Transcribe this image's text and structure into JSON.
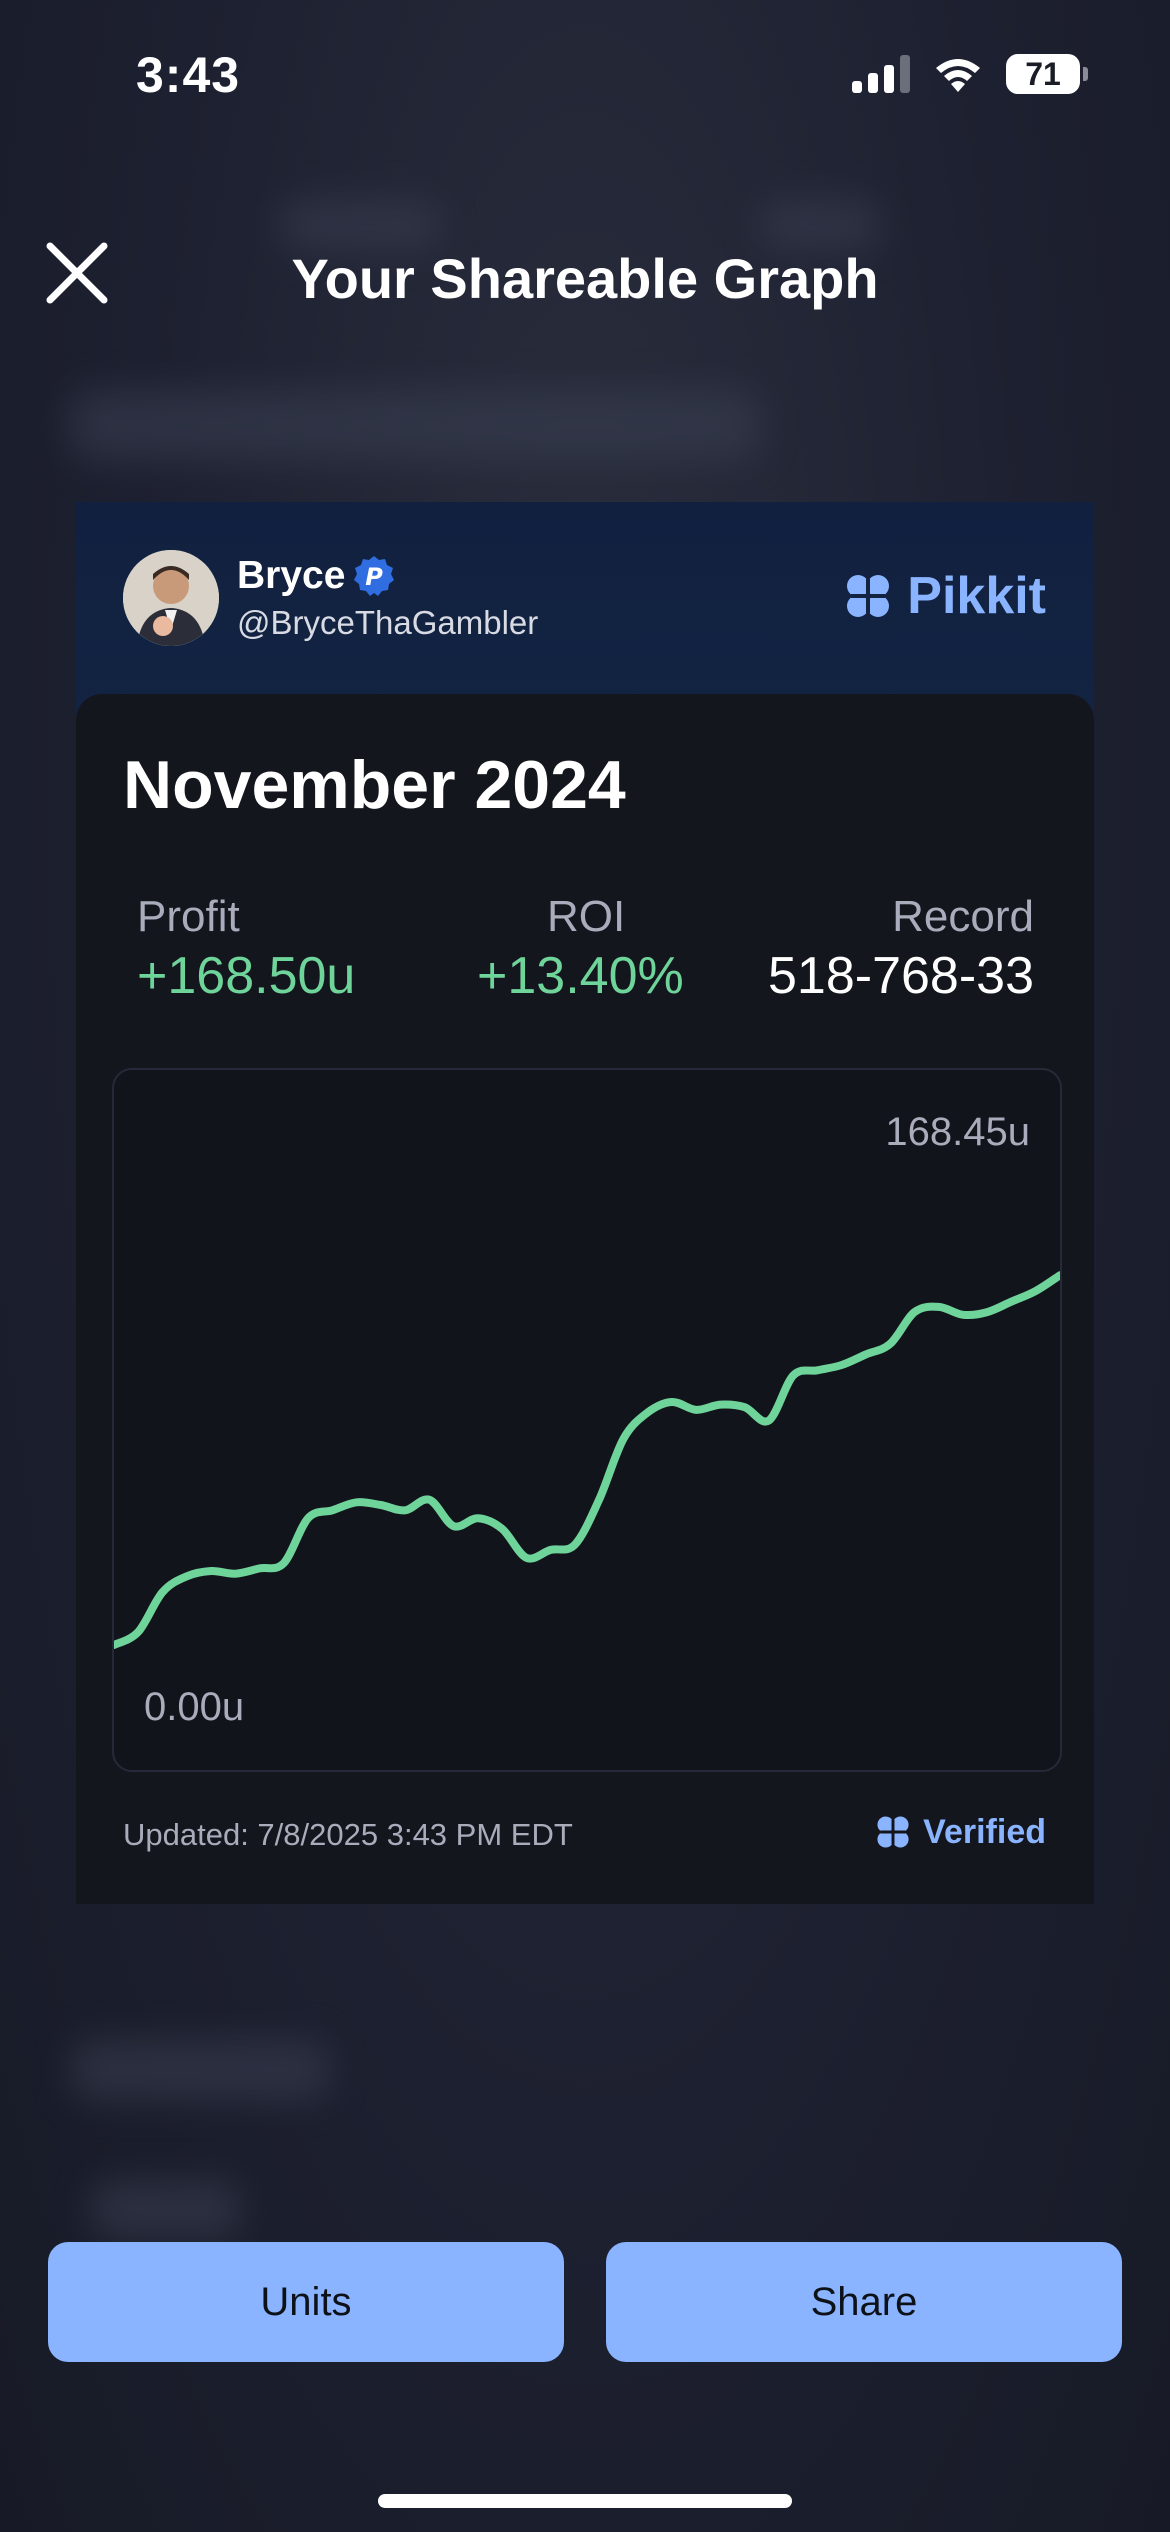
{
  "status_bar": {
    "time": "3:43",
    "battery": "71"
  },
  "header": {
    "title": "Your Shareable Graph"
  },
  "card": {
    "user": {
      "name": "Bryce",
      "handle": "@BryceThaGambler"
    },
    "brand": "Pikkit",
    "period": "November 2024",
    "stats": {
      "profit": {
        "label": "Profit",
        "value": "+168.50u"
      },
      "roi": {
        "label": "ROI",
        "value": "+13.40%"
      },
      "record": {
        "label": "Record",
        "value": "518-768-33"
      }
    },
    "graph": {
      "max_label": "168.45u",
      "min_label": "0.00u"
    },
    "updated": "Updated: 7/8/2025 3:43 PM EDT",
    "verified": "Verified"
  },
  "actions": {
    "units": "Units",
    "share": "Share"
  },
  "colors": {
    "accent": "#8ab4ff",
    "positive": "#6fd49a",
    "card_bg": "#14161e"
  },
  "chart_data": {
    "type": "line",
    "ylim": [
      0,
      168.45
    ],
    "series": [
      {
        "values": [
          0,
          5,
          20,
          26,
          28,
          27,
          29,
          31,
          48,
          51,
          54,
          53,
          51,
          55,
          45,
          48,
          44,
          33,
          36,
          38,
          55,
          78,
          88,
          92,
          89,
          91,
          90,
          85,
          102,
          104,
          106,
          110,
          114,
          126,
          128,
          125,
          126,
          130,
          134,
          140
        ]
      }
    ]
  }
}
